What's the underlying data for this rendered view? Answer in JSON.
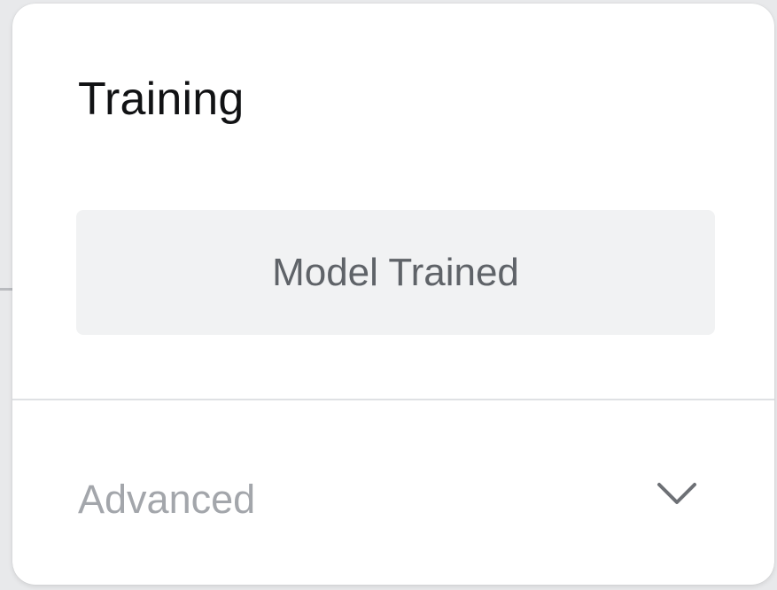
{
  "card": {
    "title": "Training",
    "status_button_label": "Model Trained",
    "advanced_label": "Advanced"
  },
  "icons": {
    "expand": "chevron-down-icon"
  },
  "colors": {
    "title": "#111214",
    "status_button_bg": "#f1f2f3",
    "status_button_text": "#5f6368",
    "advanced_text": "#a3a6ab",
    "background": "#e8e9eb"
  }
}
